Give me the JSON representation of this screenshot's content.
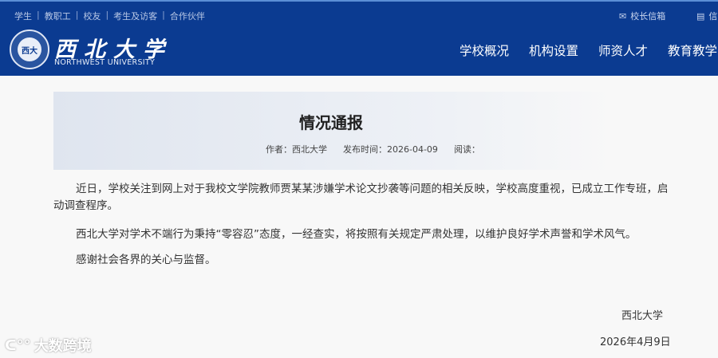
{
  "header": {
    "top_links": [
      "学生",
      "教职工",
      "校友",
      "考生及访客",
      "合作伙伴"
    ],
    "utility": [
      {
        "icon": "mailbox-icon",
        "label": "校长信箱"
      },
      {
        "icon": "document-icon",
        "label": "信"
      }
    ],
    "logo_text": "西北大学",
    "logo_en": "NORTHWEST UNIVERSITY",
    "nav": [
      "学校概况",
      "机构设置",
      "师资人才",
      "教育教学"
    ]
  },
  "article": {
    "title": "情况通报",
    "author": "作者：西北大学",
    "date": "发布时间：2026-04-09",
    "views": "阅读：",
    "p1a": "近日，学校关注到网上对于我校文学院教师贾某某涉嫌学术论文抄袭等问题的相关反映，学校高度重视，已成立工作专班，启",
    "p1b": "动调查程序。",
    "p2": "西北大学对学术不端行为秉持“零容忍”态度，一经查实，将按照有关规定严肃处理，以维护良好学术声誉和学术风气。",
    "p3": "感谢社会各界的关心与监督。",
    "signature": "西北大学",
    "sign_date": "2026年4月9日"
  },
  "watermark": "大数跨境"
}
